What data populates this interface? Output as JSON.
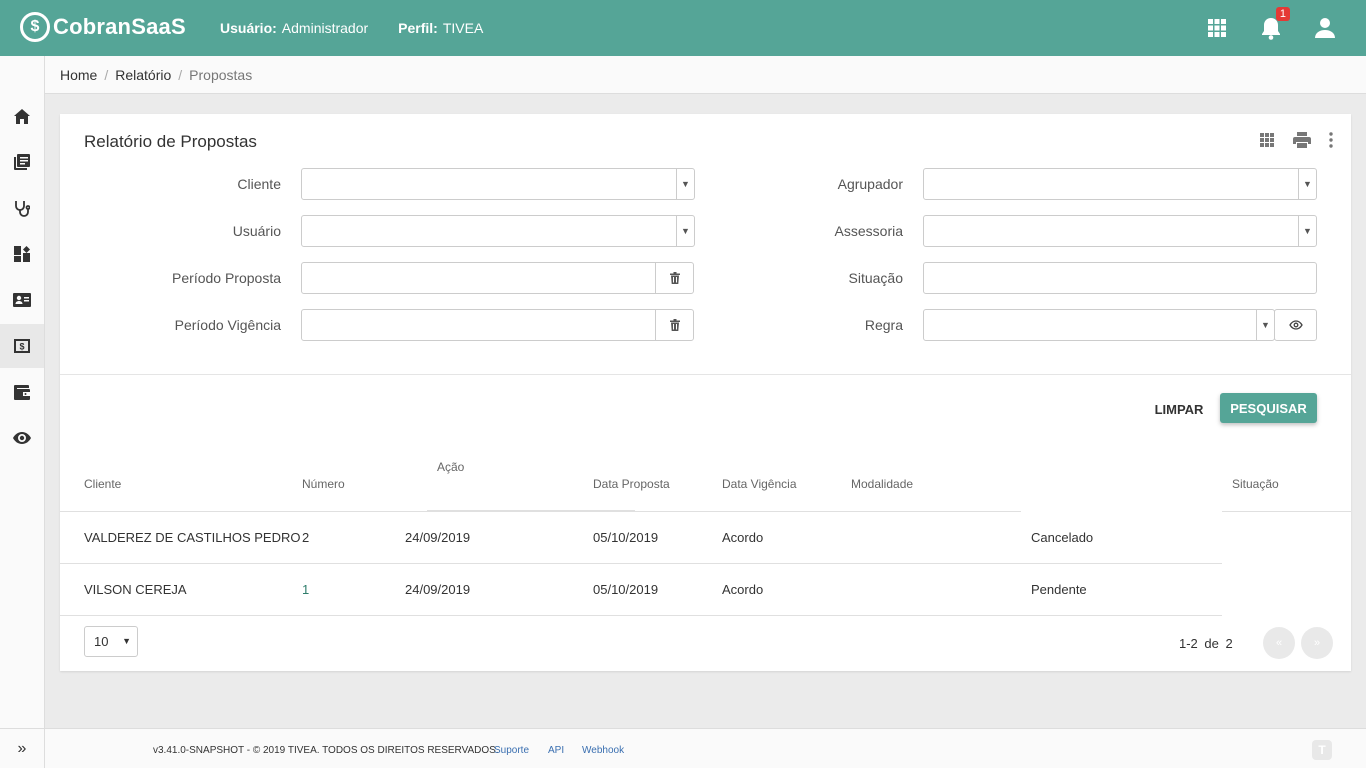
{
  "app": {
    "logo_mark": "$",
    "name": "CobranSaaS",
    "user_label": "Usuário:",
    "user_value": "Administrador",
    "profile_label": "Perfil:",
    "profile_value": "TIVEA",
    "notification_count": "1"
  },
  "sidebar": {
    "items": [
      "home-icon",
      "library-icon",
      "stethoscope-icon",
      "dashboard-icon",
      "contact-card-icon",
      "money-icon",
      "wallet-icon",
      "eye-icon"
    ],
    "active_index": 5,
    "expand_glyph": "»"
  },
  "breadcrumb": {
    "items": [
      "Home",
      "Relatório",
      "Propostas"
    ]
  },
  "card": {
    "title": "Relatório de Propostas"
  },
  "filters": {
    "cliente": "Cliente",
    "usuario": "Usuário",
    "periodo_proposta": "Período Proposta",
    "periodo_vigencia": "Período Vigência",
    "agrupador": "Agrupador",
    "assessoria": "Assessoria",
    "situacao": "Situação",
    "regra": "Regra"
  },
  "actions": {
    "limpar": "LIMPAR",
    "pesquisar": "PESQUISAR"
  },
  "table": {
    "headers": {
      "cliente": "Cliente",
      "numero": "Número",
      "acao": "Ação",
      "data_proposta": "Data Proposta",
      "data_vigencia": "Data Vigência",
      "modalidade": "Modalidade",
      "situacao": "Situação"
    },
    "rows": [
      {
        "cliente": "VALDEREZ DE CASTILHOS PEDRO",
        "numero": "2",
        "acao": "24/09/2019",
        "data_proposta": "05/10/2019",
        "data_vigencia": "Acordo",
        "situacao": "Cancelado"
      },
      {
        "cliente": "VILSON CEREJA",
        "numero": "1",
        "acao": "24/09/2019",
        "data_proposta": "05/10/2019",
        "data_vigencia": "Acordo",
        "situacao": "Pendente"
      }
    ]
  },
  "pagination": {
    "page_size": "10",
    "range": "1-2",
    "of": "de",
    "total": "2",
    "prev": "«",
    "next": "»"
  },
  "footer": {
    "copyright": "v3.41.0-SNAPSHOT - © 2019 TIVEA. TODOS OS DIREITOS RESERVADOS.",
    "links": [
      "Suporte",
      "API",
      "Webhook"
    ],
    "logo_mark": "T"
  },
  "colors": {
    "primary": "#55a597",
    "badge": "#e53935",
    "link": "#3a6fb0"
  }
}
